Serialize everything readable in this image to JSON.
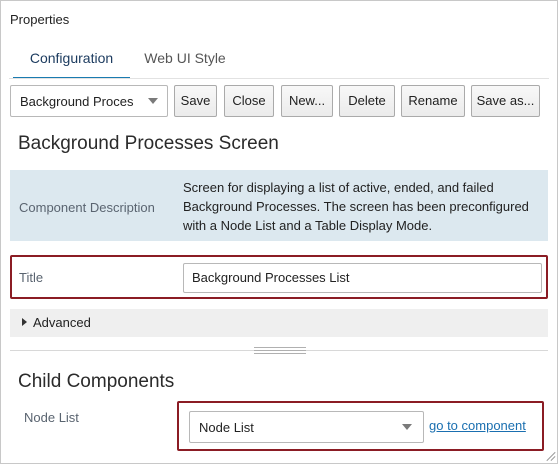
{
  "panel": {
    "title": "Properties"
  },
  "tabs": [
    {
      "label": "Configuration",
      "active": true
    },
    {
      "label": "Web UI Style",
      "active": false
    }
  ],
  "toolbar": {
    "screen_select_value": "Background Proces",
    "save_label": "Save",
    "close_label": "Close",
    "new_label": "New...",
    "delete_label": "Delete",
    "rename_label": "Rename",
    "save_as_label": "Save as..."
  },
  "screen": {
    "heading": "Background Processes Screen",
    "description_label": "Component Description",
    "description_text": "Screen for displaying a list of active, ended, and failed Background Processes. The screen has been preconfigured with a Node List and a Table Display Mode."
  },
  "title_field": {
    "label": "Title",
    "value": "Background Processes List"
  },
  "advanced": {
    "label": "Advanced"
  },
  "child_components": {
    "heading": "Child Components",
    "node_list": {
      "label": "Node List",
      "selected": "Node List",
      "link_label": "go to component"
    }
  },
  "colors": {
    "accent": "#1a7bb0",
    "highlight_border": "#8b1c24",
    "description_bg": "#dce8ef",
    "link": "#1a6fb0"
  }
}
